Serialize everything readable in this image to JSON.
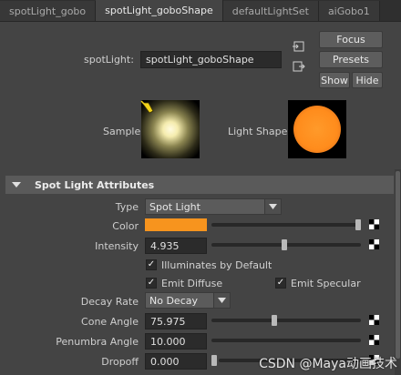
{
  "tabs": [
    {
      "label": "spotLight_gobo"
    },
    {
      "label": "spotLight_goboShape"
    },
    {
      "label": "defaultLightSet"
    },
    {
      "label": "aiGobo1"
    }
  ],
  "node": {
    "label": "spotLight:",
    "value": "spotLight_goboShape"
  },
  "buttons": {
    "focus": "Focus",
    "presets": "Presets",
    "show": "Show",
    "hide": "Hide"
  },
  "previews": {
    "sample_label": "Sample",
    "light_shape_label": "Light Shape"
  },
  "section": {
    "title": "Spot Light Attributes"
  },
  "attributes": {
    "type": {
      "label": "Type",
      "value": "Spot Light"
    },
    "color": {
      "label": "Color",
      "swatch": "#f7941e",
      "slider_fraction": 1.0
    },
    "intensity": {
      "label": "Intensity",
      "value": "4.935",
      "slider_fraction": 0.49
    },
    "illuminates_by_default": {
      "label": "Illuminates by Default",
      "checked": true
    },
    "emit_diffuse": {
      "label": "Emit Diffuse",
      "checked": true
    },
    "emit_specular": {
      "label": "Emit Specular",
      "checked": true
    },
    "decay_rate": {
      "label": "Decay Rate",
      "value": "No Decay"
    },
    "cone_angle": {
      "label": "Cone Angle",
      "value": "75.975",
      "slider_fraction": 0.42
    },
    "penumbra_angle": {
      "label": "Penumbra Angle",
      "value": "10.000"
    },
    "dropoff": {
      "label": "Dropoff",
      "value": "0.000"
    }
  },
  "watermark": "CSDN @Maya动画技术",
  "colors": {
    "background": "#444444",
    "accent_orange": "#f7941e"
  }
}
